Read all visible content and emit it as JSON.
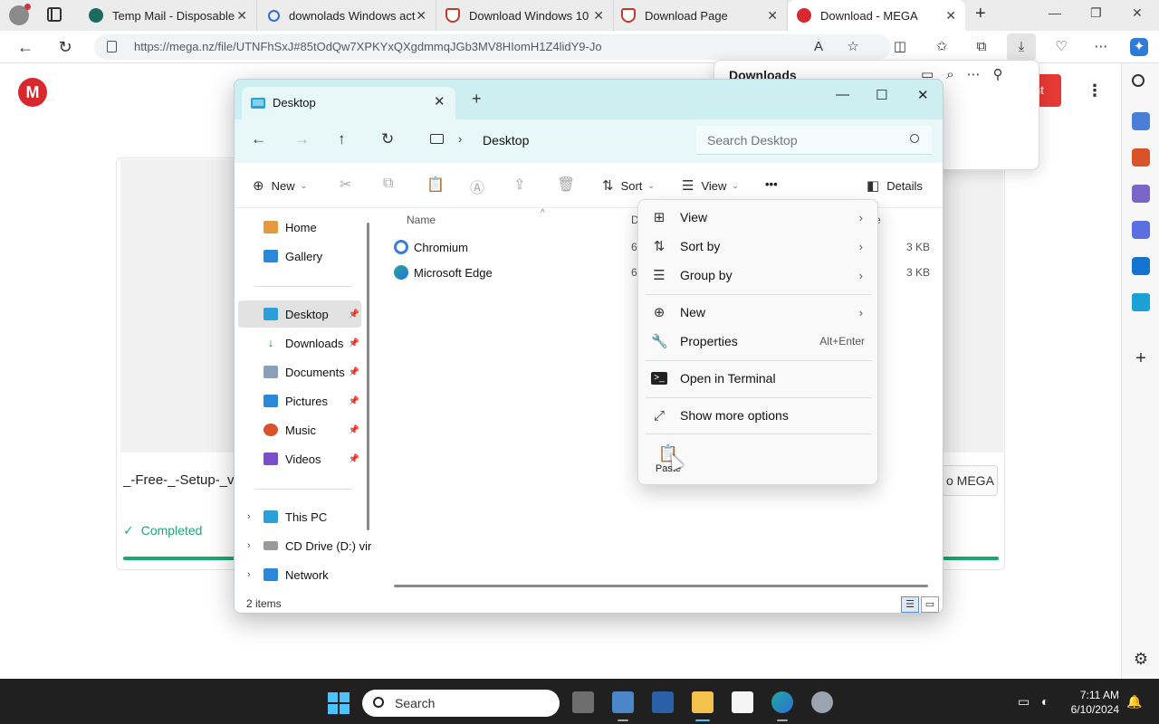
{
  "browser": {
    "tabs": [
      {
        "label": "Temp Mail - Disposable",
        "icon": "tempmail-icon",
        "color": "#1b6b63"
      },
      {
        "label": "downolads Windows act",
        "icon": "search-icon",
        "color": "#2f6fd6"
      },
      {
        "label": "Download Windows 10",
        "icon": "shield-icon",
        "color": "#c0392b"
      },
      {
        "label": "Download Page",
        "icon": "shield-icon",
        "color": "#c0392b"
      },
      {
        "label": "Download - MEGA",
        "icon": "mega-icon",
        "color": "#d9272e",
        "active": true
      }
    ],
    "url": "https://mega.nz/file/UTNFhSxJ#85tOdQw7XPKYxQXgdmmqJGb3MV8HIomH1Z4lidY9-Jo",
    "downloads_panel": {
      "title": "Downloads"
    }
  },
  "mega": {
    "logo": "M",
    "filename": "_-Free-_-Setup-_v",
    "status": "Completed",
    "button_label": "o MEGA",
    "red_button": "nt"
  },
  "explorer": {
    "tab_title": "Desktop",
    "breadcrumb": "Desktop",
    "search_placeholder": "Search Desktop",
    "commands": {
      "new": "New",
      "sort": "Sort",
      "view": "View",
      "more": "•••",
      "details": "Details"
    },
    "nav": {
      "home": "Home",
      "gallery": "Gallery",
      "desktop": "Desktop",
      "downloads": "Downloads",
      "documents": "Documents",
      "pictures": "Pictures",
      "music": "Music",
      "videos": "Videos",
      "this_pc": "This PC",
      "cd_drive": "CD Drive (D:) vir",
      "network": "Network"
    },
    "columns": {
      "name": "Name",
      "date": "D",
      "size": "ze"
    },
    "files": [
      {
        "name": "Chromium",
        "date": "6,",
        "size": "3 KB",
        "icon_color": "#3d7bd9"
      },
      {
        "name": "Microsoft Edge",
        "date": "6,",
        "size": "3 KB",
        "icon_color": "#1fa8a0"
      }
    ],
    "status": "2 items"
  },
  "context_menu": {
    "view": "View",
    "sort_by": "Sort by",
    "group_by": "Group by",
    "new": "New",
    "properties": "Properties",
    "properties_shortcut": "Alt+Enter",
    "open_terminal": "Open in Terminal",
    "show_more": "Show more options",
    "paste": "Paste"
  },
  "taskbar": {
    "search": "Search",
    "time": "7:11 AM",
    "date": "6/10/2024"
  },
  "colors": {
    "mega_red": "#d9272e",
    "completed_green": "#19a974",
    "explorer_title": "#cdeff2",
    "taskbar": "#202020",
    "accent_blue": "#4cc2ff"
  }
}
